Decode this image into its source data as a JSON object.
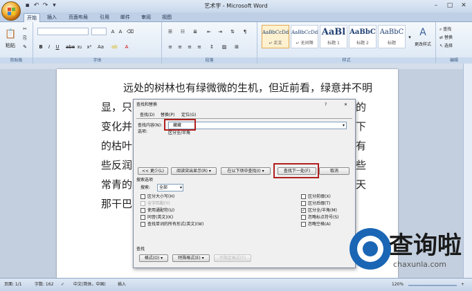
{
  "window": {
    "title": "艺术字 - Microsoft Word"
  },
  "ribbon": {
    "tabs": [
      {
        "label": "开始",
        "active": true
      },
      {
        "label": "插入",
        "active": false
      },
      {
        "label": "页面布局",
        "active": false
      },
      {
        "label": "引用",
        "active": false
      },
      {
        "label": "邮件",
        "active": false
      },
      {
        "label": "审阅",
        "active": false
      },
      {
        "label": "视图",
        "active": false
      }
    ],
    "groups": {
      "clipboard": "剪贴板",
      "font": "字体",
      "paragraph": "段落",
      "styles": "样式",
      "editing": "编辑"
    },
    "paste_label": "粘贴",
    "styles": [
      {
        "sample": "AaBbCcDd",
        "name": "↵ 正文",
        "selected": true
      },
      {
        "sample": "AaBbCcDd",
        "name": "↵ 无间隔",
        "selected": false
      },
      {
        "sample": "AaBl",
        "name": "标题 1",
        "selected": false
      },
      {
        "sample": "AaBbC",
        "name": "标题 2",
        "selected": false
      },
      {
        "sample": "AaBbC",
        "name": "标题",
        "selected": false
      }
    ],
    "change_styles": "更改样式",
    "editing": {
      "find": "查找",
      "replace": "替换",
      "select": "选择"
    }
  },
  "document": {
    "lines": [
      "远处的树林也有绿微微的生机，但近前看，绿意并不明",
      "显，只",
      "变化并",
      "的枯叶",
      "些反润",
      "常青的",
      "那干巴"
    ],
    "right_fragments": [
      "的",
      "下",
      "有",
      "些",
      "天"
    ]
  },
  "dialog": {
    "title": "查找和替换",
    "help": "?",
    "close": "✕",
    "tabs": [
      "查找(D)",
      "替换(P)",
      "定位(G)"
    ],
    "find_label": "查找内容(N):",
    "find_value": "藏藏",
    "options_label": "选项:",
    "options_value": "区分全/半角",
    "buttons": {
      "less": "<< 更少(L)",
      "reading_highlight": "阅读突出显示(R) ▾",
      "find_in": "在以下项中查找(I) ▾",
      "find_next": "查找下一处(F)",
      "cancel": "取消"
    },
    "search_options_title": "搜索选项",
    "search_label": "搜索:",
    "search_value": "全部",
    "left_options": [
      {
        "label": "区分大小写(H)",
        "checked": false,
        "enabled": true
      },
      {
        "label": "全字匹配(Y)",
        "checked": false,
        "enabled": false
      },
      {
        "label": "使用通配符(U)",
        "checked": false,
        "enabled": true
      },
      {
        "label": "同音(英文)(K)",
        "checked": false,
        "enabled": true
      },
      {
        "label": "查找单词的所有形式(英文)(W)",
        "checked": false,
        "enabled": true
      }
    ],
    "right_options": [
      {
        "label": "区分前缀(X)",
        "checked": false
      },
      {
        "label": "区分后缀(T)",
        "checked": false
      },
      {
        "label": "区分全/半角(M)",
        "checked": true
      },
      {
        "label": "忽略标点符号(S)",
        "checked": false
      },
      {
        "label": "忽略空格(A)",
        "checked": false
      }
    ],
    "find_section_label": "查找",
    "format_button": "格式(O) ▾",
    "special_button": "特殊格式(E) ▾",
    "no_format_button": "不限定格式(T)"
  },
  "status": {
    "page": "页面: 1/1",
    "words": "字数: 162",
    "language": "中文(简体，中国)",
    "mode": "插入",
    "zoom": "120%"
  },
  "watermark": {
    "text": "查询啦",
    "url": "chaxunla.com"
  },
  "colors": {
    "highlight_box": "#b01e1e",
    "ribbon_bg": "#dce7f4",
    "watermark_blue": "#1a66b5"
  }
}
